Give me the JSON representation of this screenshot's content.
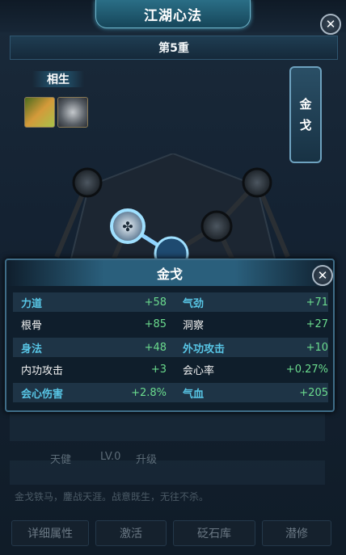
{
  "window": {
    "title": "江湖心法",
    "close_label": "✕"
  },
  "tier": {
    "label": "第5重"
  },
  "xiangsheng": {
    "label": "相生",
    "slots": [
      "item-slot-a",
      "item-slot-b"
    ]
  },
  "side_button": {
    "chars": [
      "金",
      "戈"
    ]
  },
  "popup": {
    "title": "金戈",
    "close_label": "✕",
    "rows": [
      {
        "left_label": "力道",
        "left_value": "+58",
        "right_label": "气劲",
        "right_value": "+71"
      },
      {
        "left_label": "根骨",
        "left_value": "+85",
        "right_label": "洞察",
        "right_value": "+27"
      },
      {
        "left_label": "身法",
        "left_value": "+48",
        "right_label": "外功攻击",
        "right_value": "+10"
      },
      {
        "left_label": "内功攻击",
        "left_value": "+3",
        "right_label": "会心率",
        "right_value": "+0.27%"
      },
      {
        "left_label": "会心伤害",
        "left_value": "+2.8%",
        "right_label": "气血",
        "right_value": "+205"
      }
    ]
  },
  "skill": {
    "name": "天健",
    "level": "LV.0",
    "upgrade": "升级"
  },
  "description": "金戈铁马，鏖战天涯。战意既生，无往不杀。",
  "buttons": {
    "detail": "详细属性",
    "activate": "激活",
    "stone": "砭石库",
    "cultivate": "潜修"
  },
  "colors": {
    "accent": "#58c6e6",
    "value_green": "#6bdc8e",
    "panel": "#142232"
  }
}
